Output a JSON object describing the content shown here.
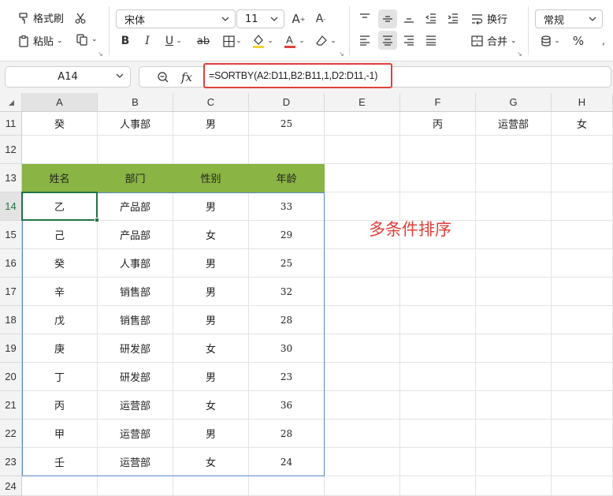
{
  "ribbon": {
    "format_painter": "格式刷",
    "paste": "粘贴",
    "font_name": "宋体",
    "font_size": "11",
    "wrap_text": "换行",
    "merge": "合并",
    "number_format": "常规",
    "percent": "%"
  },
  "formula_bar": {
    "name_box": "A14",
    "fx": "fx",
    "formula": "=SORTBY(A2:D11,B2:B11,1,D2:D11,-1)"
  },
  "columns": [
    "A",
    "B",
    "C",
    "D",
    "E",
    "F",
    "G",
    "H"
  ],
  "rows": [
    "11",
    "12",
    "13",
    "14",
    "15",
    "16",
    "17",
    "18",
    "19",
    "20",
    "21",
    "22",
    "23",
    "24"
  ],
  "row11": {
    "a": "癸",
    "b": "人事部",
    "c": "男",
    "d": "25",
    "f": "丙",
    "g": "运营部",
    "h": "女"
  },
  "table_header": [
    "姓名",
    "部门",
    "性别",
    "年龄"
  ],
  "table_rows": [
    [
      "乙",
      "产品部",
      "男",
      "33"
    ],
    [
      "己",
      "产品部",
      "女",
      "29"
    ],
    [
      "癸",
      "人事部",
      "男",
      "25"
    ],
    [
      "辛",
      "销售部",
      "男",
      "32"
    ],
    [
      "戊",
      "销售部",
      "男",
      "28"
    ],
    [
      "庚",
      "研发部",
      "女",
      "30"
    ],
    [
      "丁",
      "研发部",
      "男",
      "23"
    ],
    [
      "丙",
      "运营部",
      "女",
      "36"
    ],
    [
      "甲",
      "运营部",
      "男",
      "28"
    ],
    [
      "壬",
      "运营部",
      "女",
      "24"
    ]
  ],
  "annotation": "多条件排序",
  "colors": {
    "header_fill": "#8ab443",
    "highlight_red": "#e0403a",
    "selection_green": "#217346",
    "table_border": "#5b87c4"
  }
}
